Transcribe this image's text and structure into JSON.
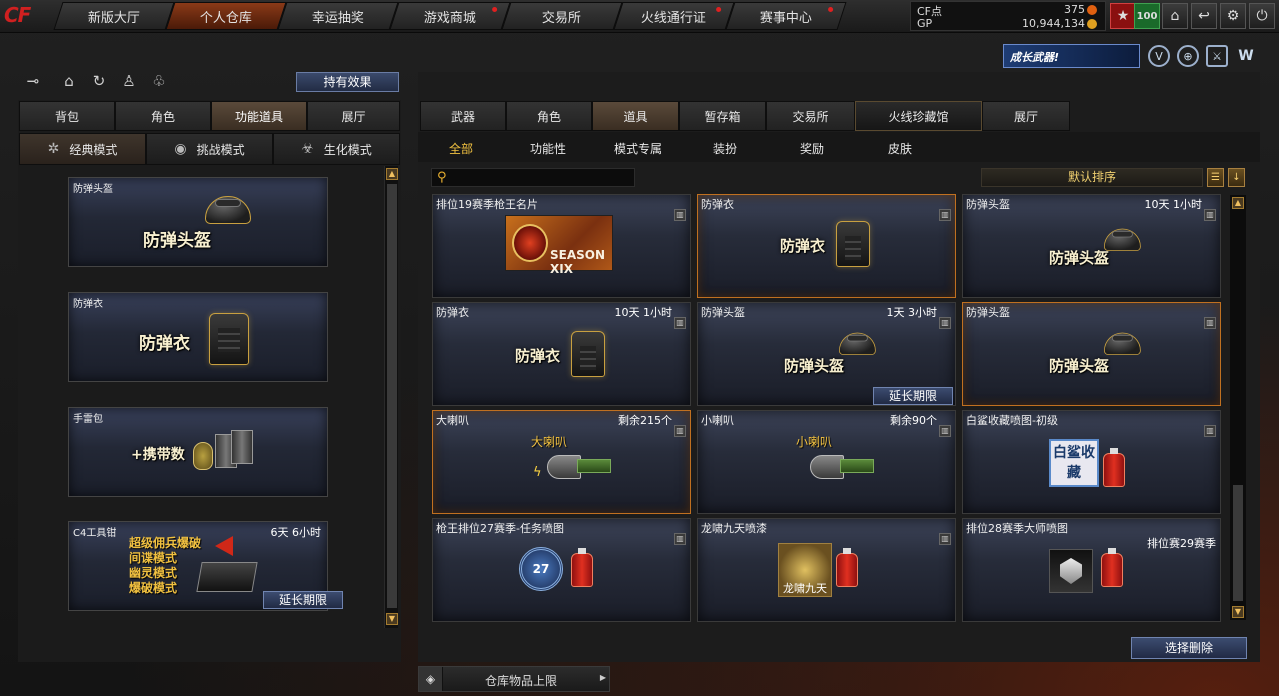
{
  "nav": {
    "logo": "CF",
    "tabs": [
      {
        "label": "新版大厅"
      },
      {
        "label": "个人仓库"
      },
      {
        "label": "幸运抽奖"
      },
      {
        "label": "游戏商城"
      },
      {
        "label": "交易所"
      },
      {
        "label": "火线通行证"
      },
      {
        "label": "赛事中心"
      }
    ],
    "active_tab": "个人仓库",
    "currency": {
      "cf_label": "CF点",
      "cf_value": "375",
      "gp_label": "GP",
      "gp_value": "10,944,134"
    },
    "level": "100"
  },
  "promo": {
    "grow_weapon": "成长武器!"
  },
  "left": {
    "effect_button": "持有效果",
    "tabs": [
      "背包",
      "角色",
      "功能道具",
      "展厅"
    ],
    "active_tab": "功能道具",
    "modes": [
      "经典模式",
      "挑战模式",
      "生化模式"
    ],
    "active_mode": "经典模式",
    "items": [
      {
        "name": "防弹头盔",
        "label": "防弹头盔",
        "time": ""
      },
      {
        "name": "防弹衣",
        "label": "防弹衣",
        "time": ""
      },
      {
        "name": "手雷包",
        "label": "+携带数",
        "time": ""
      },
      {
        "name": "C4工具钳",
        "label": "",
        "time": "6天 6小时",
        "modes": [
          "超级佣兵爆破",
          "间谍模式",
          "幽灵模式",
          "爆破模式"
        ],
        "extend": "延长期限"
      }
    ]
  },
  "right": {
    "tabs": [
      "武器",
      "角色",
      "道具",
      "暂存箱",
      "交易所",
      "火线珍藏馆",
      "展厅"
    ],
    "active_tab": "道具",
    "subtabs": [
      "全部",
      "功能性",
      "模式专属",
      "装扮",
      "奖励",
      "皮肤"
    ],
    "active_subtab": "全部",
    "sort_label": "默认排序",
    "items": [
      {
        "name": "排位19赛季枪王名片",
        "time": "",
        "art": "SEASON XIX"
      },
      {
        "name": "防弹衣",
        "time": "",
        "art": "防弹衣"
      },
      {
        "name": "防弹头盔",
        "time": "10天 1小时",
        "art": "防弹头盔"
      },
      {
        "name": "防弹衣",
        "time": "10天 1小时",
        "art": "防弹衣"
      },
      {
        "name": "防弹头盔",
        "time": "1天 3小时",
        "art": "防弹头盔",
        "extend": "延长期限"
      },
      {
        "name": "防弹头盔",
        "time": "",
        "art": "防弹头盔"
      },
      {
        "name": "大喇叭",
        "time": "剩余215个",
        "art": "大喇叭"
      },
      {
        "name": "小喇叭",
        "time": "剩余90个",
        "art": "小喇叭"
      },
      {
        "name": "白鲨收藏喷图-初级",
        "time": "",
        "art": "白鲨收藏"
      },
      {
        "name": "枪王排位27赛季-任务喷图",
        "time": "",
        "art": "27"
      },
      {
        "name": "龙啸九天喷漆",
        "time": "",
        "art": "龙啸九天"
      },
      {
        "name": "排位28赛季大师喷图",
        "time": "排位赛29赛季",
        "art": ""
      }
    ],
    "delete_button": "选择删除",
    "capacity_label": "仓库物品上限"
  }
}
